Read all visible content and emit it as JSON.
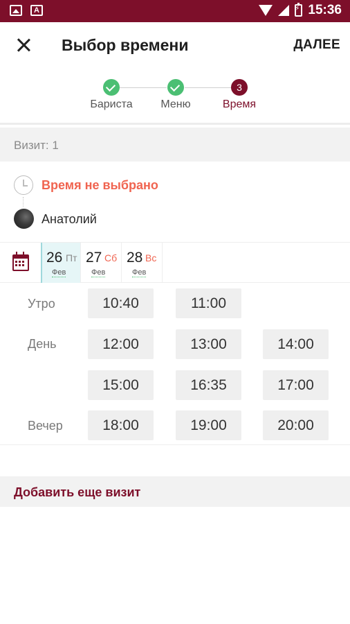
{
  "status_bar": {
    "time": "15:36",
    "icons": [
      "image-icon",
      "font-icon",
      "wifi-icon",
      "signal-icon",
      "battery-icon"
    ],
    "color": "#7d0f2a"
  },
  "toolbar": {
    "title": "Выбор времени",
    "next_label": "ДАЛЕЕ",
    "close_icon": "close-icon"
  },
  "stepper": {
    "steps": [
      {
        "label": "Бариста",
        "state": "done",
        "number": ""
      },
      {
        "label": "Меню",
        "state": "done",
        "number": ""
      },
      {
        "label": "Время",
        "state": "active",
        "number": "3"
      }
    ],
    "done_color": "#4bbf73",
    "active_color": "#7d0f2a"
  },
  "visit": {
    "label": "Визит: 1"
  },
  "info": {
    "time_status": "Время не выбрано",
    "master_name": "Анатолий",
    "warning_color": "#f06450"
  },
  "dates": [
    {
      "day": "26",
      "weekday": "Пт",
      "month": "Фев",
      "selected": true
    },
    {
      "day": "27",
      "weekday": "Сб",
      "month": "Фев",
      "selected": false
    },
    {
      "day": "28",
      "weekday": "Вс",
      "month": "Фев",
      "selected": false
    }
  ],
  "slots": {
    "morning_label": "Утро",
    "day_label": "День",
    "evening_label": "Вечер",
    "morning": [
      "10:40",
      "11:00"
    ],
    "day": [
      "12:00",
      "13:00",
      "14:00",
      "15:00",
      "16:35",
      "17:00"
    ],
    "evening": [
      "18:00",
      "19:00",
      "20:00"
    ]
  },
  "add_visit_label": "Добавить еще визит"
}
